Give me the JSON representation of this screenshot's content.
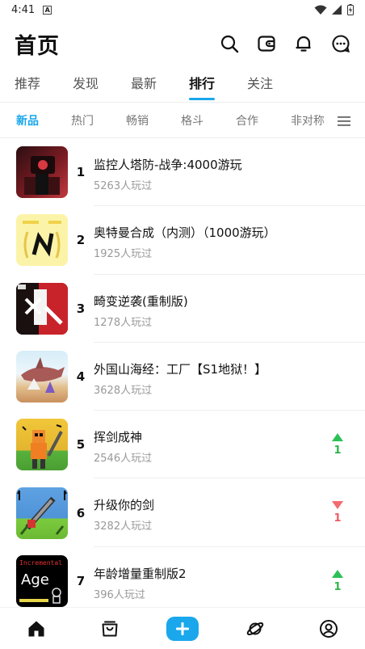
{
  "status_bar": {
    "time": "4:41",
    "badge": "A"
  },
  "header": {
    "title": "首页",
    "icons": [
      "search-icon",
      "wallet-icon",
      "bell-icon",
      "message-icon"
    ]
  },
  "main_tabs": [
    {
      "label": "推荐",
      "active": false
    },
    {
      "label": "发现",
      "active": false
    },
    {
      "label": "最新",
      "active": false
    },
    {
      "label": "排行",
      "active": true
    },
    {
      "label": "关注",
      "active": false
    }
  ],
  "sub_tabs": [
    {
      "label": "新品",
      "active": true
    },
    {
      "label": "热门",
      "active": false
    },
    {
      "label": "畅销",
      "active": false
    },
    {
      "label": "格斗",
      "active": false
    },
    {
      "label": "合作",
      "active": false
    },
    {
      "label": "非对称",
      "active": false
    }
  ],
  "list": [
    {
      "rank": "1",
      "title": "监控人塔防-战争:4000游玩",
      "plays": "5263人玩过",
      "trend": null,
      "thumb_colors": [
        "#4a1a1f",
        "#b32a30"
      ]
    },
    {
      "rank": "2",
      "title": "奥特曼合成（内测）（1000游玩）",
      "plays": "1925人玩过",
      "trend": null,
      "thumb_colors": [
        "#fbf5b8",
        "#f2e27a"
      ]
    },
    {
      "rank": "3",
      "title": "畸变逆袭(重制版)",
      "plays": "1278人玩过",
      "trend": null,
      "thumb_colors": [
        "#1d1111",
        "#d0232a"
      ]
    },
    {
      "rank": "4",
      "title": "外国山海经：工厂【S1地狱！】",
      "plays": "3628人玩过",
      "trend": null,
      "thumb_colors": [
        "#cfe8f5",
        "#d9b98c"
      ]
    },
    {
      "rank": "5",
      "title": "挥剑成神",
      "plays": "2546人玩过",
      "trend": {
        "direction": "up",
        "value": "1"
      },
      "thumb_colors": [
        "#e7c23b",
        "#4fae3a"
      ]
    },
    {
      "rank": "6",
      "title": "升级你的剑",
      "plays": "3282人玩过",
      "trend": {
        "direction": "down",
        "value": "1"
      },
      "thumb_colors": [
        "#5aa0e0",
        "#7cc940"
      ]
    },
    {
      "rank": "7",
      "title": "年龄增量重制版2",
      "plays": "396人玩过",
      "trend": {
        "direction": "up",
        "value": "1"
      },
      "thumb_colors": [
        "#000000",
        "#222222"
      ]
    }
  ],
  "thumb_texts": {
    "t7_top": "Incremental",
    "t7_main": "Age"
  },
  "bottom_nav": [
    "home-icon",
    "shop-icon",
    "add-icon",
    "planet-icon",
    "profile-icon"
  ],
  "colors": {
    "accent": "#1aa7ec",
    "up": "#2cc158",
    "down": "#f36a71"
  }
}
